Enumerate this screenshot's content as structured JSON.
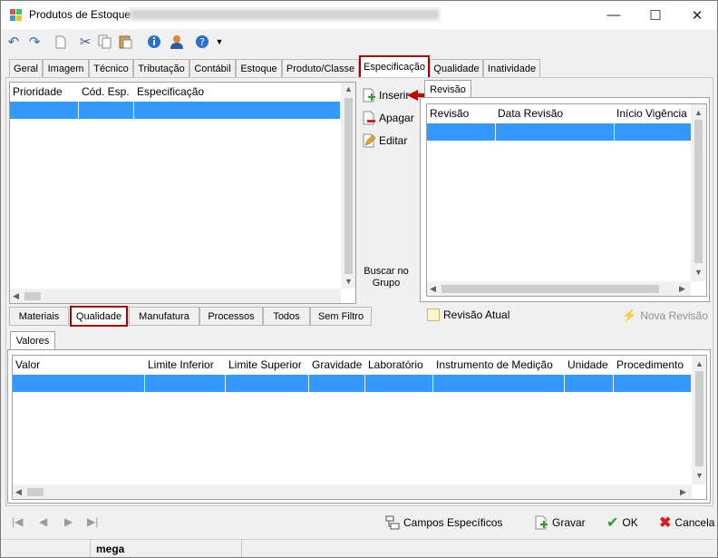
{
  "window": {
    "title": "Produtos de Estoque",
    "controls": {
      "minimize": "—",
      "maximize": "☐",
      "close": "✕"
    }
  },
  "tabs_top": [
    "Geral",
    "Imagem",
    "Técnico",
    "Tributação",
    "Contábil",
    "Estoque",
    "Produto/Classe",
    "Especificação",
    "Qualidade",
    "Inatividade"
  ],
  "active_tab": "Especificação",
  "spec_grid": {
    "columns": [
      "Prioridade",
      "Cód. Esp.",
      "Especificação"
    ]
  },
  "side_actions": {
    "inserir": "Inserir",
    "apagar": "Apagar",
    "editar": "Editar",
    "buscar": "Buscar no Grupo"
  },
  "revisao": {
    "tab": "Revisão",
    "columns": [
      "Revisão",
      "Data Revisão",
      "Início Vigência"
    ],
    "atual": "Revisão Atual",
    "nova": "Nova Revisão"
  },
  "subtabs": [
    "Materiais",
    "Qualidade",
    "Manufatura",
    "Processos",
    "Todos",
    "Sem Filtro"
  ],
  "active_subtab": "Qualidade",
  "valores": {
    "tab": "Valores",
    "columns": [
      "Valor",
      "Limite Inferior",
      "Limite Superior",
      "Gravidade",
      "Laboratório",
      "Instrumento de Medição",
      "Unidade",
      "Procedimento"
    ]
  },
  "footer": {
    "campos": "Campos Específicos",
    "gravar": "Gravar",
    "ok": "OK",
    "cancela": "Cancela"
  },
  "status": {
    "user": "mega"
  },
  "colors": {
    "selection": "#3399ff",
    "highlight_border": "#a60000",
    "arrow": "#c00000"
  }
}
